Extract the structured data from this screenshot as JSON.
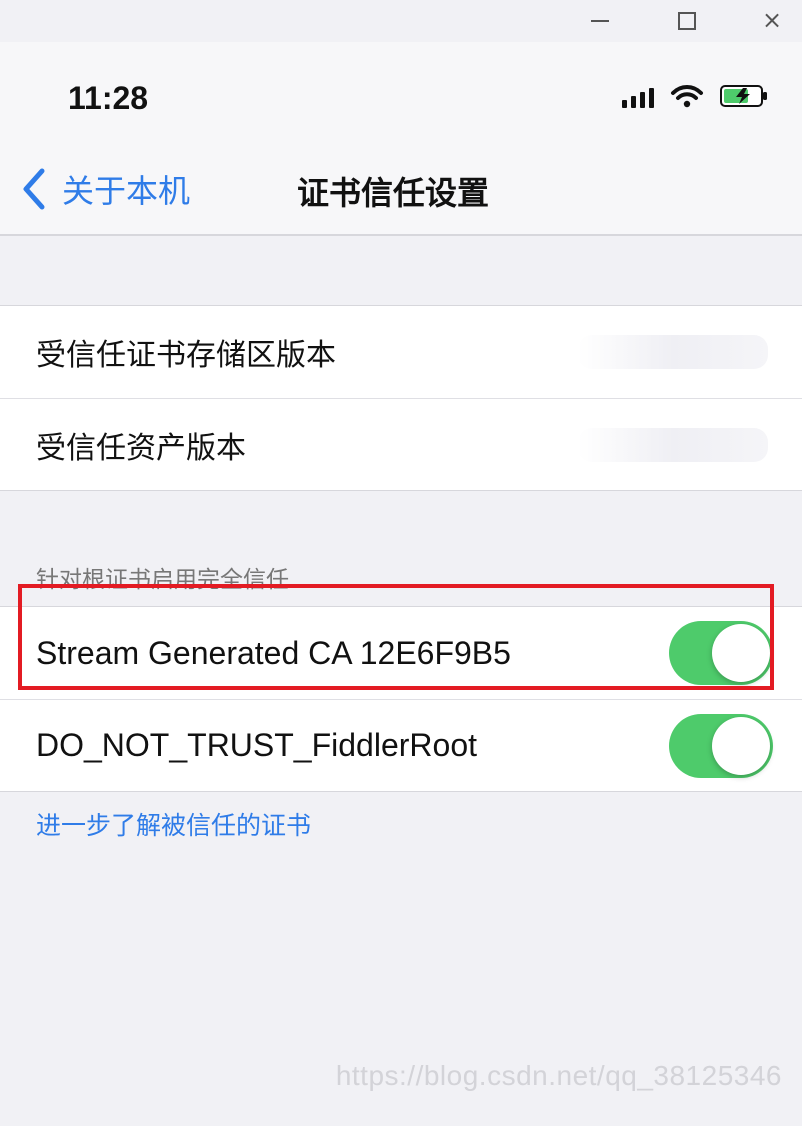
{
  "window_controls": {
    "minimize": "minimize",
    "maximize": "maximize",
    "close": "×"
  },
  "status_bar": {
    "time": "11:28",
    "icons": [
      "signal-icon",
      "wifi-icon",
      "battery-charging-icon"
    ]
  },
  "nav": {
    "back_label": "关于本机",
    "title": "证书信任设置"
  },
  "versions": {
    "items": [
      {
        "label": "受信任证书存储区版本"
      },
      {
        "label": "受信任资产版本"
      }
    ]
  },
  "root_trust": {
    "header": "针对根证书启用完全信任",
    "items": [
      {
        "label": "Stream Generated CA 12E6F9B5",
        "enabled": true
      },
      {
        "label": "DO_NOT_TRUST_FiddlerRoot",
        "enabled": true
      }
    ]
  },
  "footer": {
    "link": "进一步了解被信任的证书"
  },
  "watermark": "https://blog.csdn.net/qq_38125346",
  "colors": {
    "accent": "#2f7ce8",
    "toggle_on": "#4ecb6b",
    "highlight": "#e31b23",
    "background": "#f1f1f5"
  }
}
